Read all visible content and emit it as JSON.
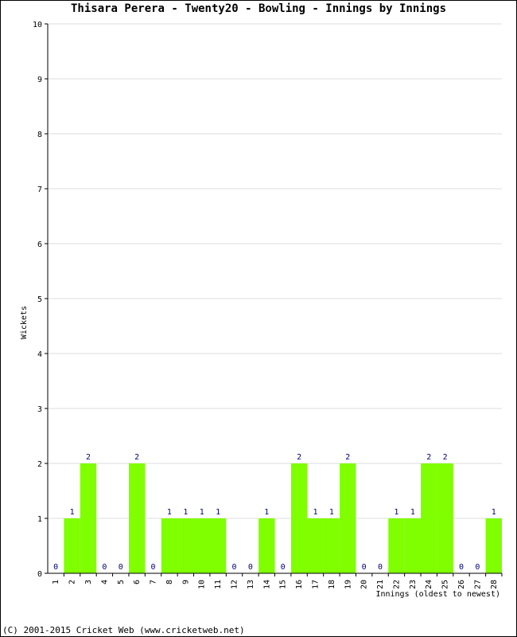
{
  "chart_data": {
    "type": "bar",
    "title": "Thisara Perera - Twenty20 - Bowling - Innings by Innings",
    "xlabel": "Innings (oldest to newest)",
    "ylabel": "Wickets",
    "ylim": [
      0,
      10
    ],
    "yticks": [
      0,
      1,
      2,
      3,
      4,
      5,
      6,
      7,
      8,
      9,
      10
    ],
    "grid": true,
    "bar_color": "#7fff00",
    "label_color": "#000080",
    "categories": [
      "1",
      "2",
      "3",
      "4",
      "5",
      "6",
      "7",
      "8",
      "9",
      "10",
      "11",
      "12",
      "13",
      "14",
      "15",
      "16",
      "17",
      "18",
      "19",
      "20",
      "21",
      "22",
      "23",
      "24",
      "25",
      "26",
      "27",
      "28"
    ],
    "values": [
      0,
      1,
      2,
      0,
      0,
      2,
      0,
      1,
      1,
      1,
      1,
      0,
      0,
      1,
      0,
      2,
      1,
      1,
      2,
      0,
      0,
      1,
      1,
      2,
      2,
      0,
      0,
      1
    ]
  },
  "footer": "(C) 2001-2015 Cricket Web (www.cricketweb.net)"
}
